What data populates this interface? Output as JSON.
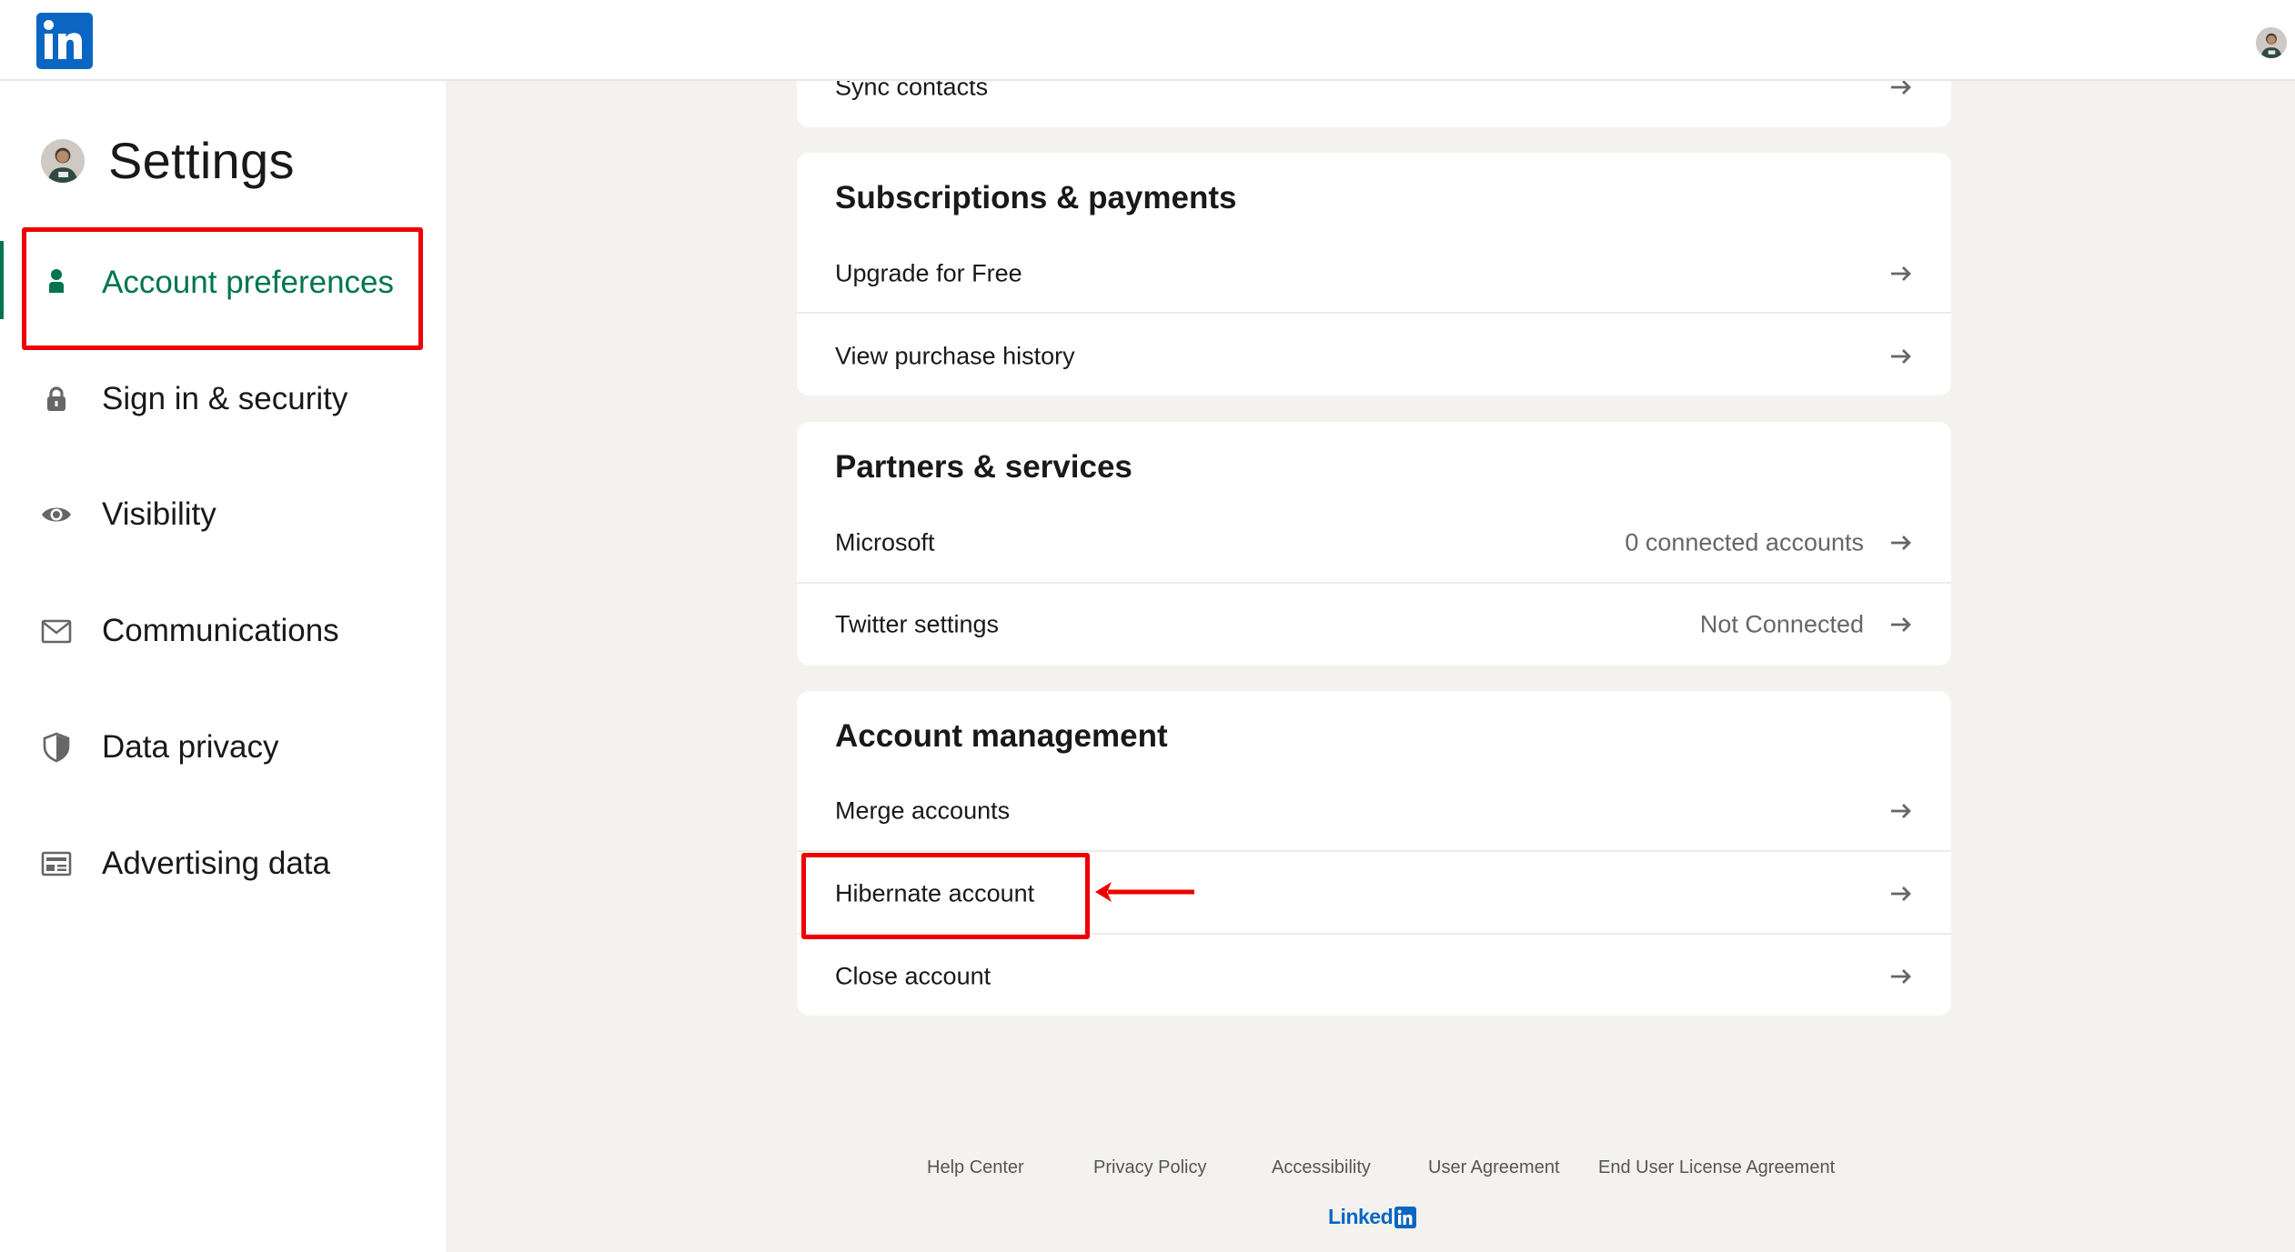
{
  "header": {
    "logo_icon": "linkedin-logo-icon",
    "profile_avatar": "profile-avatar"
  },
  "sidebar": {
    "title": "Settings",
    "items": [
      {
        "label": "Account preferences",
        "icon": "person-icon",
        "active": true
      },
      {
        "label": "Sign in & security",
        "icon": "lock-icon",
        "active": false
      },
      {
        "label": "Visibility",
        "icon": "eye-icon",
        "active": false
      },
      {
        "label": "Communications",
        "icon": "envelope-icon",
        "active": false
      },
      {
        "label": "Data privacy",
        "icon": "shield-icon",
        "active": false
      },
      {
        "label": "Advertising data",
        "icon": "ad-card-icon",
        "active": false
      }
    ]
  },
  "main": {
    "sections": [
      {
        "title": "",
        "rows": [
          {
            "label": "Sync contacts",
            "value": ""
          }
        ]
      },
      {
        "title": "Subscriptions & payments",
        "rows": [
          {
            "label": "Upgrade for Free",
            "value": ""
          },
          {
            "label": "View purchase history",
            "value": ""
          }
        ]
      },
      {
        "title": "Partners & services",
        "rows": [
          {
            "label": "Microsoft",
            "value": "0 connected accounts"
          },
          {
            "label": "Twitter settings",
            "value": "Not Connected"
          }
        ]
      },
      {
        "title": "Account management",
        "rows": [
          {
            "label": "Merge accounts",
            "value": ""
          },
          {
            "label": "Hibernate account",
            "value": ""
          },
          {
            "label": "Close account",
            "value": ""
          }
        ]
      }
    ]
  },
  "footer": {
    "links": [
      "Help Center",
      "Privacy Policy",
      "Accessibility",
      "User Agreement",
      "End User License Agreement"
    ],
    "brand_text": "Linked"
  },
  "annotations": {
    "highlight_color": "#ee0000",
    "highlighted": [
      "Account preferences",
      "Hibernate account"
    ]
  },
  "colors": {
    "brand_blue": "#0a66c2",
    "active_green": "#01754f",
    "page_bg": "#f3f2ef"
  }
}
